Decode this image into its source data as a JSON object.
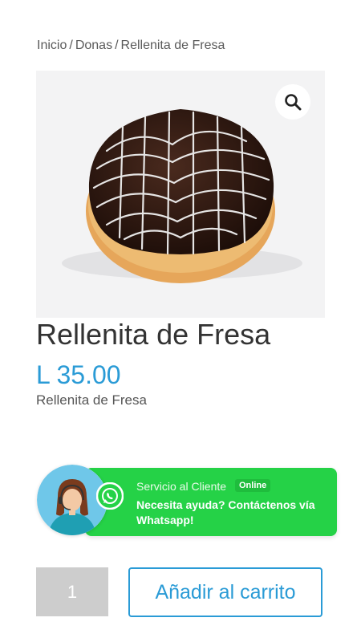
{
  "breadcrumb": {
    "home": "Inicio",
    "category": "Donas",
    "current": "Rellenita de Fresa",
    "separator": "/"
  },
  "product": {
    "title": "Rellenita de Fresa",
    "price": "L 35.00",
    "short_description": "Rellenita de Fresa",
    "image_icon": "donut-photo",
    "zoom_icon": "magnifier-icon"
  },
  "whatsapp_widget": {
    "service_label": "Servicio al Cliente",
    "status_badge": "Online",
    "help_text": "Necesita ayuda? Contáctenos vía Whatsapp!",
    "icon": "whatsapp-icon",
    "avatar": "support-agent-avatar"
  },
  "cart": {
    "quantity": "1",
    "add_label": "Añadir al carrito"
  },
  "colors": {
    "accent": "#2a9bd6",
    "whatsapp_green": "#25d247",
    "qty_bg": "#cdcdcd"
  }
}
